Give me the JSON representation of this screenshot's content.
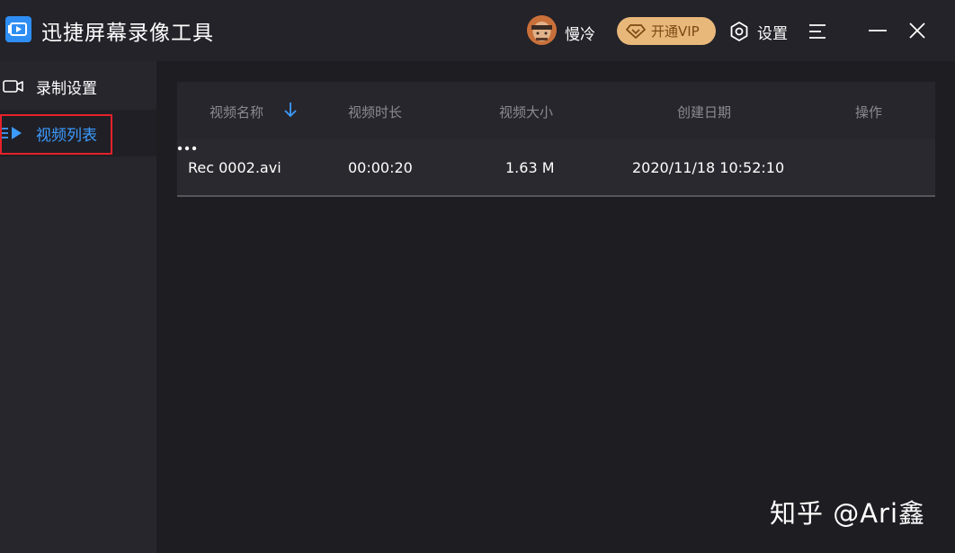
{
  "app": {
    "title": "迅捷屏幕录像工具",
    "brand_color": "#2f8ef4"
  },
  "header": {
    "user_name": "慢冷",
    "vip_label": "开通VIP",
    "settings_label": "设置",
    "icons": [
      "app-logo-icon",
      "avatar",
      "diamond-icon",
      "gear-icon",
      "menu-icon",
      "minimize-icon",
      "close-icon"
    ]
  },
  "sidebar": {
    "items": [
      {
        "label": "录制设置",
        "icon": "camera-icon",
        "active": false
      },
      {
        "label": "视频列表",
        "icon": "video-list-icon",
        "active": true
      }
    ],
    "active_color": "#3d9bff"
  },
  "table": {
    "columns": [
      "视频名称",
      "视频时长",
      "视频大小",
      "创建日期",
      "操作"
    ],
    "sort": {
      "column": "视频名称",
      "direction": "down",
      "icon": "sort-down-arrow-icon"
    },
    "rows": [
      {
        "name": "Rec 0002.avi",
        "duration": "00:00:20",
        "size": "1.63 M",
        "date": "2020/11/18 10:52:10",
        "action_icon": "more-icon"
      }
    ]
  },
  "watermark": "知乎 @Ari鑫"
}
